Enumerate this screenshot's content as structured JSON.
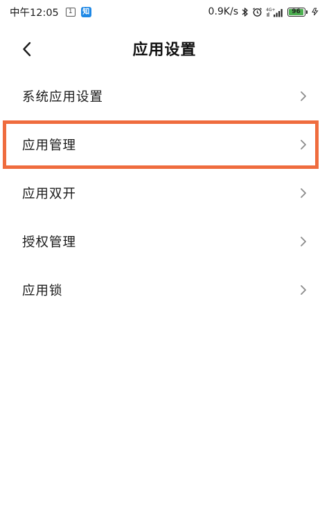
{
  "status_bar": {
    "time": "中午12:05",
    "calendar_day": "1",
    "app_badge": "知",
    "net_speed": "0.9K/s",
    "signal_label": "4G+",
    "battery_level": "96",
    "battery_color": "#4caf50"
  },
  "header": {
    "title": "应用设置",
    "back_icon": "chevron-left-icon"
  },
  "menu": {
    "items": [
      {
        "label": "系统应用设置",
        "highlighted": false
      },
      {
        "label": "应用管理",
        "highlighted": true
      },
      {
        "label": "应用双开",
        "highlighted": false
      },
      {
        "label": "授权管理",
        "highlighted": false
      },
      {
        "label": "应用锁",
        "highlighted": false
      }
    ],
    "highlight_color": "#ef6c3e",
    "chevron_icon": "chevron-right-icon"
  }
}
